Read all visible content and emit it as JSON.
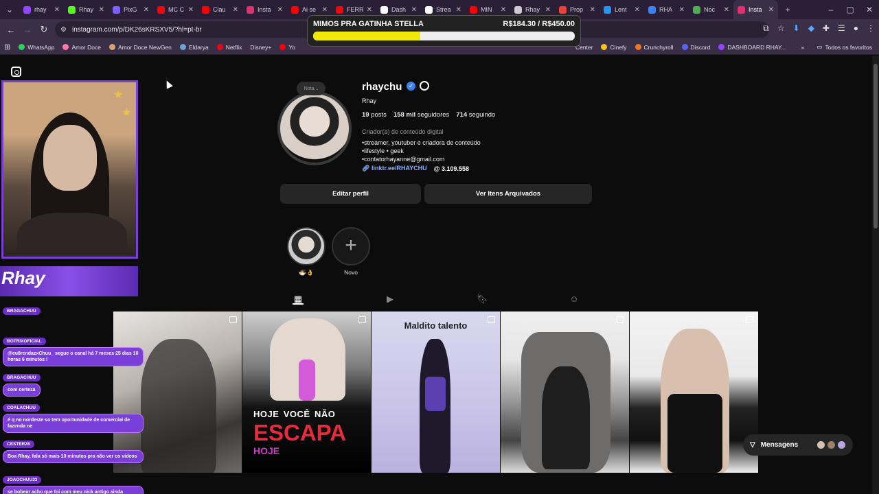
{
  "browser": {
    "tabs": [
      {
        "label": "rhay",
        "color": "#9146ff"
      },
      {
        "label": "Rhay",
        "color": "#53fc18"
      },
      {
        "label": "PixG",
        "color": "#7b61ff"
      },
      {
        "label": "MC C",
        "color": "#ff0000"
      },
      {
        "label": "Clau",
        "color": "#ff0000"
      },
      {
        "label": "Insta",
        "color": "#e1306c"
      },
      {
        "label": "Ai se",
        "color": "#ff0000"
      },
      {
        "label": "FERR",
        "color": "#ff0000"
      },
      {
        "label": "Dash",
        "color": "#ffffff"
      },
      {
        "label": "Strea",
        "color": "#ffffff"
      },
      {
        "label": "MIN",
        "color": "#ff0000"
      },
      {
        "label": "Rhay",
        "color": "#cccccc"
      },
      {
        "label": "Prop",
        "color": "#ea4335"
      },
      {
        "label": "Lent",
        "color": "#2196f3"
      },
      {
        "label": "RHA",
        "color": "#3b82f6"
      },
      {
        "label": "Noc",
        "color": "#4caf50"
      },
      {
        "label": "Insta",
        "color": "#e1306c",
        "active": true
      }
    ],
    "new_tab": "+",
    "url": "instagram.com/p/DK26sKRSXV5/?hl=pt-br",
    "bookmarks": [
      {
        "label": "WhatsApp",
        "color": "#25d366"
      },
      {
        "label": "Amor Doce",
        "color": "#ff7aa8"
      },
      {
        "label": "Amor Doce NewGen",
        "color": "#d8a56a"
      },
      {
        "label": "Eldarya",
        "color": "#6aa5d8"
      },
      {
        "label": "Netflix",
        "color": "#e50914"
      },
      {
        "label": "Disney+",
        "color": "#1a3ca0"
      },
      {
        "label": "Yo",
        "color": "#ff0000"
      },
      {
        "label": "Center",
        "color": "#3b2f48"
      },
      {
        "label": "Cinefy",
        "color": "#f5c518"
      },
      {
        "label": "Crunchyroll",
        "color": "#f47521"
      },
      {
        "label": "Discord",
        "color": "#5865f2"
      },
      {
        "label": "DASHBOARD RHAY...",
        "color": "#9146ff"
      }
    ],
    "all_favorites": "Todos os favoritos"
  },
  "goal_widget": {
    "title": "MIMOS PRA GATINHA STELLA",
    "amount": "R$184.30 / R$450.00",
    "progress": 0.41
  },
  "profile": {
    "note": "Nota...",
    "username": "rhaychu",
    "full_name": "Rhay",
    "posts": "19",
    "posts_label": "posts",
    "followers": "158 mil",
    "followers_label": "seguidores",
    "following": "714",
    "following_label": "seguindo",
    "category": "Criador(a) de conteúdo digital",
    "bio": [
      "•streamer, youtuber e criadora de conteúdo",
      "•lifestyle • geek",
      "•contatorhayanne@gmail.com"
    ],
    "link": "linktr.ee/RHAYCHU",
    "threads": "3.109.558",
    "edit_button": "Editar perfil",
    "archive_button": "Ver Itens Arquivados",
    "highlights": [
      {
        "label": "🍜👌"
      },
      {
        "label": "Novo"
      }
    ]
  },
  "posts": [
    {
      "overlay": ""
    },
    {
      "overlay_line1": "HOJE",
      "overlay_small": "VOCÊ",
      "overlay_line1b": "NÃO",
      "overlay_line2": "ESCAPA",
      "overlay_line3": "HOJE"
    },
    {
      "overlay": "Maldito talento"
    },
    {
      "overlay": ""
    },
    {
      "overlay": ""
    }
  ],
  "messages_button": "Mensagens",
  "stream_overlay": {
    "banner_text": "Rhay",
    "chat": [
      {
        "user": "BRAGACHUU",
        "msg": ""
      },
      {
        "user": "BOTRIXOFICIAL",
        "msg": "@eu8rendazxChuu_ segue o canal há 7 meses 25 dias 10 horas 6 minutos !"
      },
      {
        "user": "BRAGACHUU",
        "msg": "com certeza"
      },
      {
        "user": "COALACHUU",
        "msg": "é q no nordeste so tem oportunidade de comercial de fazenda ne"
      },
      {
        "user": "CESTER28",
        "msg": "Boa Rhay, fala só mais 10 minutos pra não ver os videos"
      },
      {
        "user": "JOAOCHUU33",
        "msg": "se bobear acho que foi com meu nick antigo ainda"
      }
    ]
  }
}
